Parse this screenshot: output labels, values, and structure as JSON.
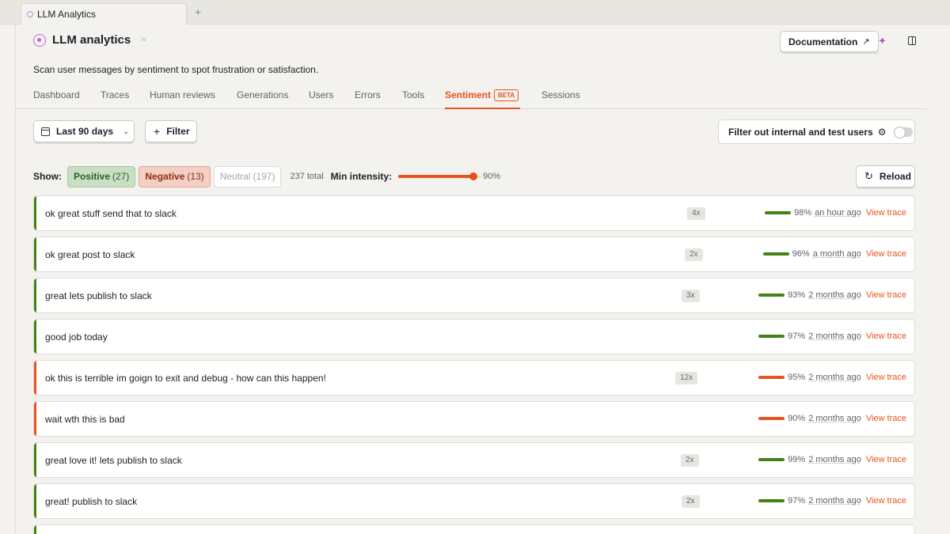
{
  "browser": {
    "tab_label": "LLM Analytics",
    "new_tab": "+"
  },
  "header": {
    "title": "LLM analytics",
    "chevron": "≍",
    "docs_label": "Documentation",
    "subtitle": "Scan user messages by sentiment to spot frustration or satisfaction."
  },
  "tabs": [
    {
      "label": "Dashboard"
    },
    {
      "label": "Traces"
    },
    {
      "label": "Human reviews"
    },
    {
      "label": "Generations"
    },
    {
      "label": "Users"
    },
    {
      "label": "Errors"
    },
    {
      "label": "Tools"
    },
    {
      "label": "Sentiment",
      "badge": "BETA",
      "active": true
    },
    {
      "label": "Sessions"
    }
  ],
  "toolbar": {
    "date_label": "Last 90 days",
    "filter_label": "Filter",
    "internal_label": "Filter out internal and test users",
    "internal_enabled": false,
    "reload_label": "Reload"
  },
  "show": {
    "label": "Show:",
    "positive_label": "Positive",
    "positive_count": "(27)",
    "negative_label": "Negative",
    "negative_count": "(13)",
    "neutral_label": "Neutral",
    "neutral_count": "(197)",
    "total": "237 total",
    "min_intensity_label": "Min intensity:",
    "min_intensity_value": 0.9,
    "min_intensity_text": "90%"
  },
  "colors": {
    "positive": "#458215",
    "negative": "#e8521e",
    "accent": "#e8521e"
  },
  "messages": [
    {
      "text": "ok great stuff send that to slack",
      "count": "4x",
      "sentiment": "positive",
      "intensity": "98%",
      "time": "an hour ago",
      "action": "View trace"
    },
    {
      "text": "ok great post to slack",
      "count": "2x",
      "sentiment": "positive",
      "intensity": "96%",
      "time": "a month ago",
      "action": "View trace"
    },
    {
      "text": "great lets publish to slack",
      "count": "3x",
      "sentiment": "positive",
      "intensity": "93%",
      "time": "2 months ago",
      "action": "View trace"
    },
    {
      "text": "good job today",
      "count": "",
      "sentiment": "positive",
      "intensity": "97%",
      "time": "2 months ago",
      "action": "View trace"
    },
    {
      "text": "ok this is terrible im goign to exit and debug - how can this happen!",
      "count": "12x",
      "sentiment": "negative",
      "intensity": "95%",
      "time": "2 months ago",
      "action": "View trace"
    },
    {
      "text": "wait wth this is bad",
      "count": "",
      "sentiment": "negative",
      "intensity": "90%",
      "time": "2 months ago",
      "action": "View trace"
    },
    {
      "text": "great love it! lets publish to slack",
      "count": "2x",
      "sentiment": "positive",
      "intensity": "99%",
      "time": "2 months ago",
      "action": "View trace"
    },
    {
      "text": "great! publish to slack",
      "count": "2x",
      "sentiment": "positive",
      "intensity": "97%",
      "time": "2 months ago",
      "action": "View trace"
    }
  ]
}
